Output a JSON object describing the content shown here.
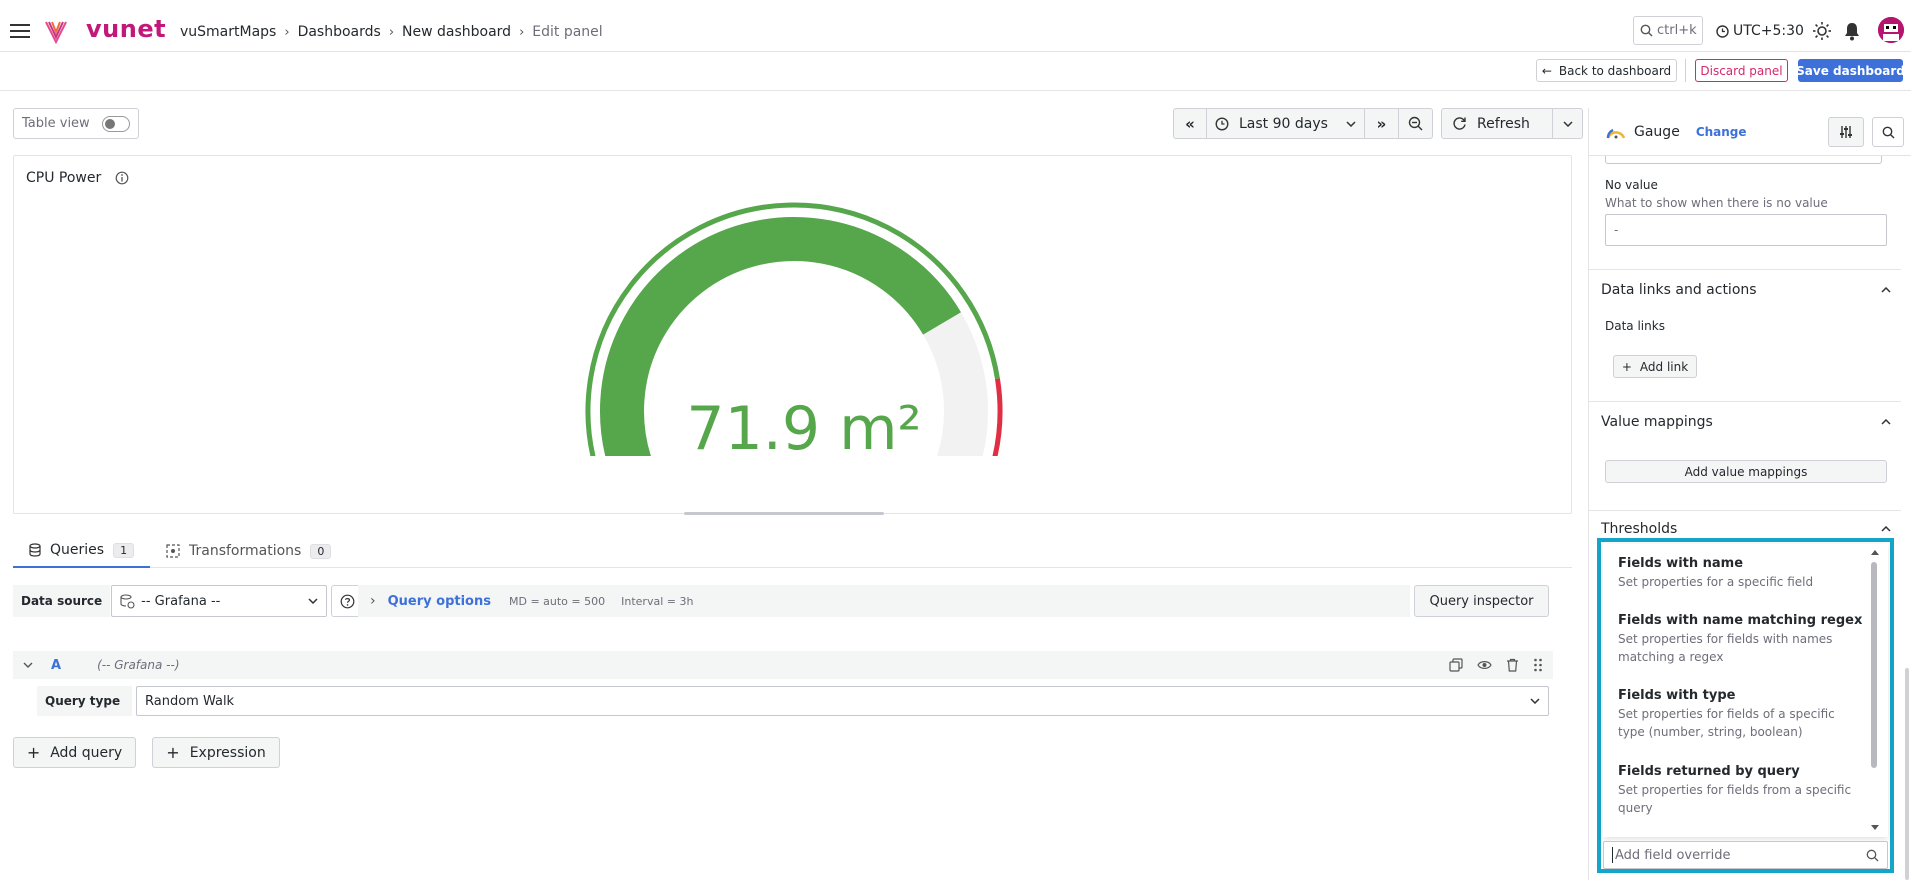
{
  "topbar": {
    "logo_text": "vunet",
    "breadcrumbs": [
      "vuSmartMaps",
      "Dashboards",
      "New dashboard",
      "Edit panel"
    ],
    "search_hint": "ctrl+k",
    "timezone": "UTC+5:30"
  },
  "toolbar": {
    "back_label": "Back to dashboard",
    "discard_label": "Discard panel",
    "save_label": "Save dashboard"
  },
  "view_controls": {
    "table_view_label": "Table view",
    "time_range": "Last 90 days",
    "refresh_label": "Refresh"
  },
  "panel": {
    "title": "CPU Power",
    "gauge_value": "71.9 m²",
    "gauge_fraction": 0.72,
    "colors": {
      "green": "#56a64b",
      "red": "#e02f44",
      "yellow": "#eab839",
      "track": "#f2f2f2"
    }
  },
  "query_tabs": {
    "queries_label": "Queries",
    "queries_count": "1",
    "transformations_label": "Transformations",
    "transformations_count": "0"
  },
  "query_row": {
    "data_source_label": "Data source",
    "data_source_value": "-- Grafana --",
    "query_options_label": "Query options",
    "md_text": "MD = auto = 500",
    "interval_text": "Interval = 3h",
    "inspector_label": "Query inspector"
  },
  "query_a": {
    "ref": "A",
    "source": "(-- Grafana --)",
    "query_type_label": "Query type",
    "query_type_value": "Random Walk"
  },
  "query_actions": {
    "add_query_label": "Add query",
    "expression_label": "Expression"
  },
  "sidebar": {
    "viz_name": "Gauge",
    "change_label": "Change",
    "no_value_title": "No value",
    "no_value_desc": "What to show when there is no value",
    "no_value_placeholder": "-",
    "data_links_title": "Data links and actions",
    "data_links_label": "Data links",
    "add_link_label": "Add link",
    "value_mappings_title": "Value mappings",
    "add_value_mappings_label": "Add value mappings",
    "thresholds_title": "Thresholds",
    "override_placeholder": "Add field override"
  },
  "override_menu": [
    {
      "title": "Fields with name",
      "desc": "Set properties for a specific field"
    },
    {
      "title": "Fields with name matching regex",
      "desc": "Set properties for fields with names matching a regex"
    },
    {
      "title": "Fields with type",
      "desc": "Set properties for fields of a specific type (number, string, boolean)"
    },
    {
      "title": "Fields returned by query",
      "desc": "Set properties for fields from a specific query"
    }
  ]
}
